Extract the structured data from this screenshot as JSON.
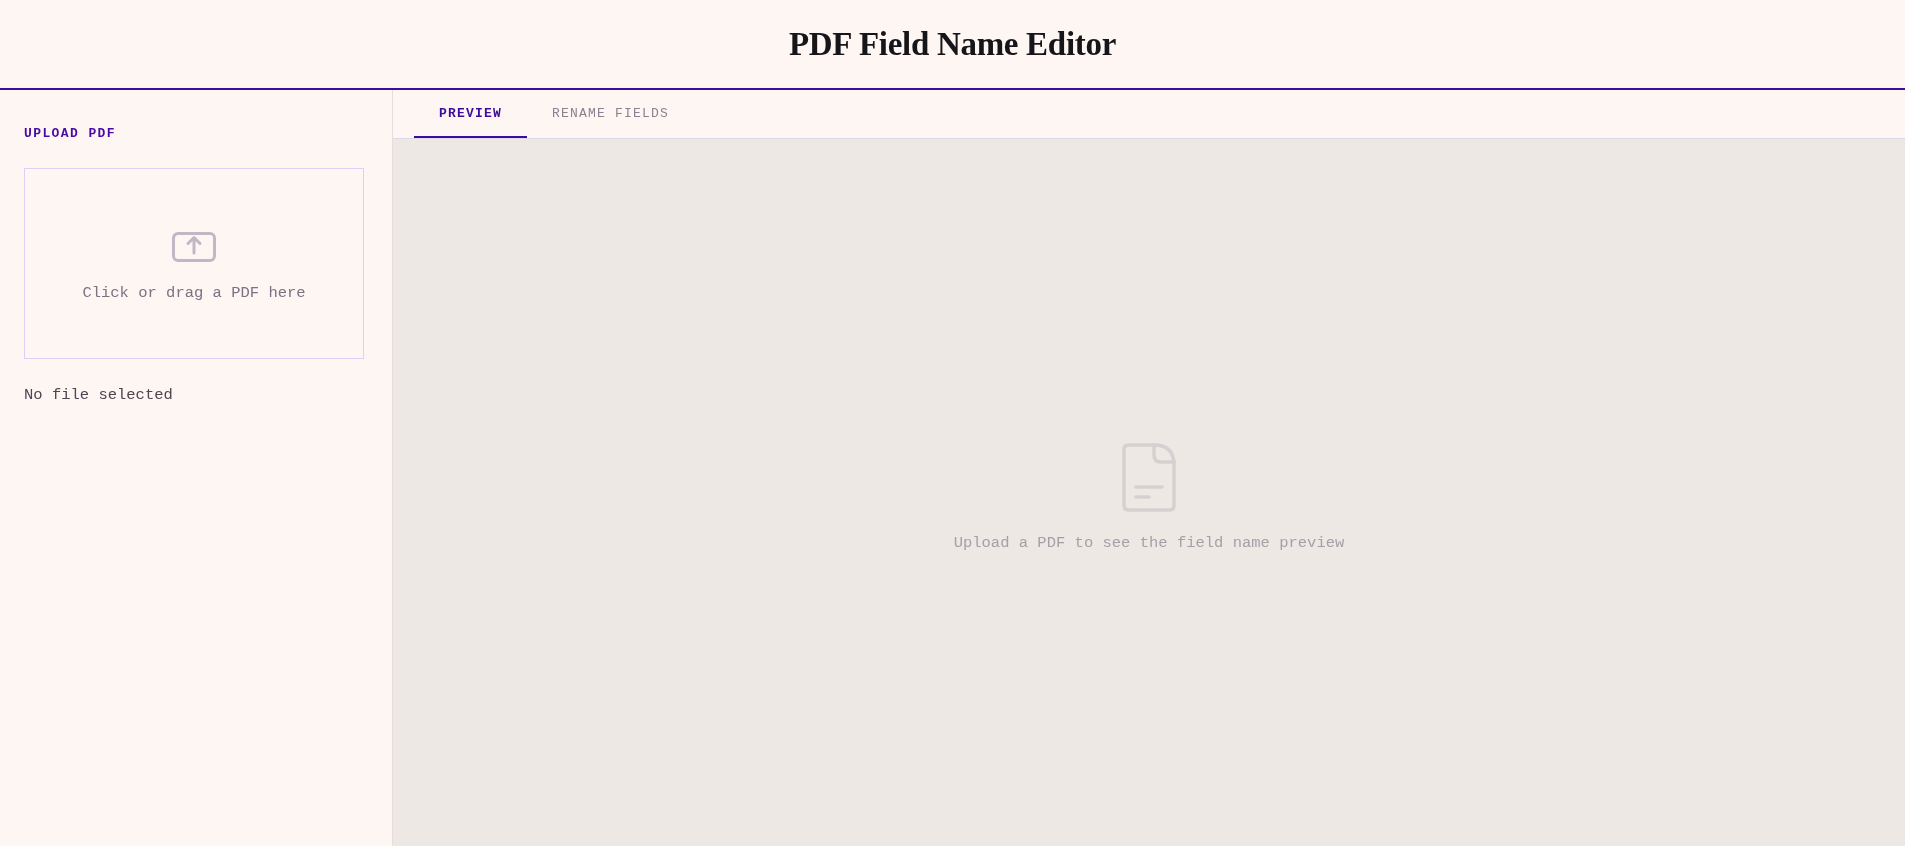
{
  "header": {
    "title": "PDF Field Name Editor"
  },
  "sidebar": {
    "heading": "UPLOAD PDF",
    "dropzone": {
      "label": "Click or drag a PDF here"
    },
    "file_status": "No file selected"
  },
  "tabs": [
    {
      "label": "PREVIEW",
      "selected": true
    },
    {
      "label": "RENAME FIELDS",
      "selected": false
    }
  ],
  "preview": {
    "empty_message": "Upload a PDF to see the field name preview"
  }
}
